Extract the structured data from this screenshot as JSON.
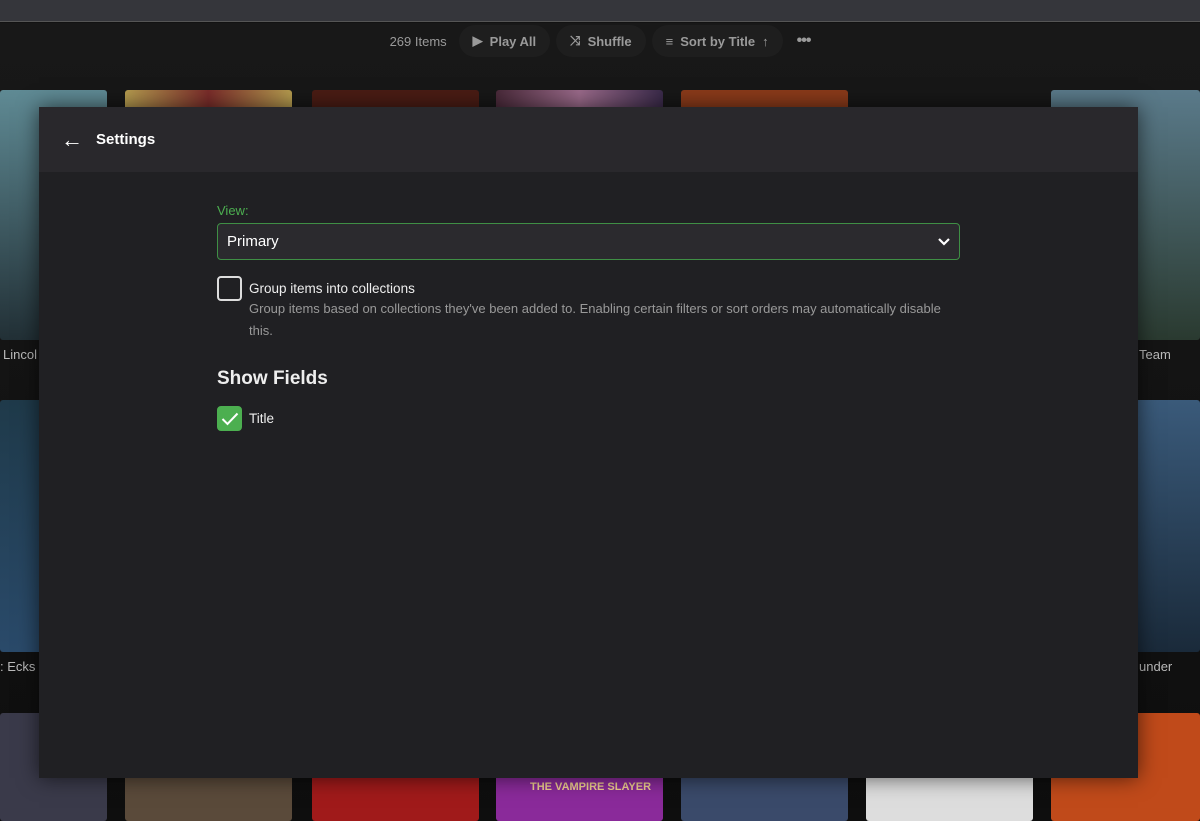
{
  "toolbar": {
    "item_count": "269 Items",
    "play_all": "Play All",
    "shuffle": "Shuffle",
    "sort": "Sort by Title",
    "more_icon": "more-horizontal-icon"
  },
  "posters": {
    "labels": [
      "Lincol",
      "Team",
      ": Ecks",
      "under"
    ],
    "vampire_title": "THE VAMPIRE SLAYER"
  },
  "dialog": {
    "title": "Settings",
    "view_label": "View:",
    "view_value": "Primary",
    "group_label": "Group items into collections",
    "group_checked": false,
    "group_desc": "Group items based on collections they've been added to. Enabling certain filters or sort orders may automatically disable this.",
    "show_fields_heading": "Show Fields",
    "fields": [
      {
        "label": "Title",
        "checked": true
      }
    ]
  },
  "colors": {
    "accent": "#4caf50",
    "dialog_bg": "#202023",
    "header_bg": "#29282c"
  }
}
